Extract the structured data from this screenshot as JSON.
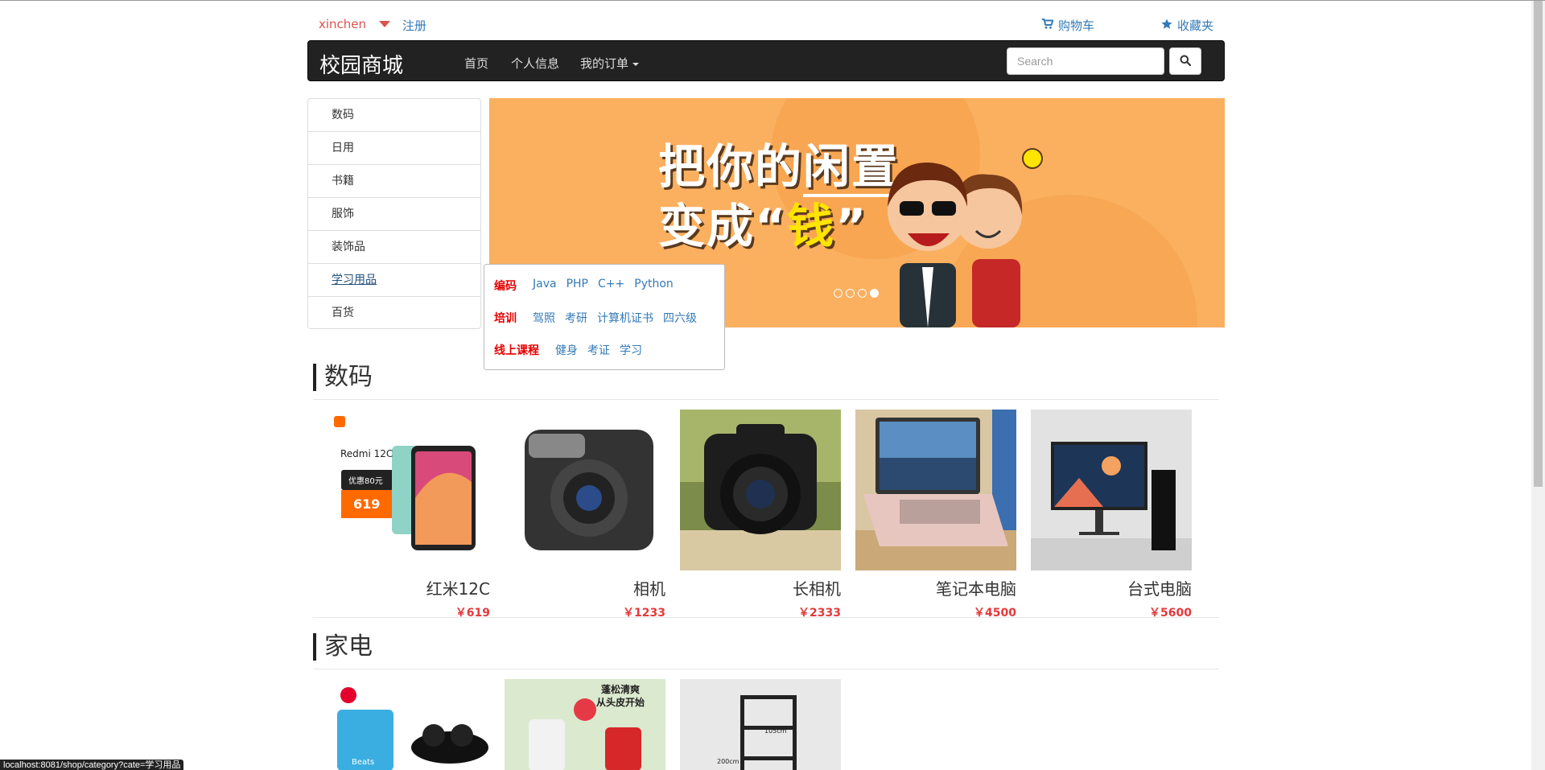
{
  "topbar": {
    "username": "xinchen",
    "register": "注册",
    "cart": "购物车",
    "favorites": "收藏夹"
  },
  "navbar": {
    "brand": "校园商城",
    "items": [
      "首页",
      "个人信息",
      "我的订单"
    ],
    "search_placeholder": "Search"
  },
  "categories": [
    "数码",
    "日用",
    "书籍",
    "服饰",
    "装饰品",
    "学习用品",
    "百货"
  ],
  "banner": {
    "line1_a": "把你的",
    "line1_b": "闲置",
    "line2_a": "变成“",
    "line2_b": "钱",
    "line2_c": "”",
    "dots_active": 4,
    "dots_total": 4
  },
  "popup": {
    "rows": [
      {
        "head": "编码",
        "links": [
          "Java",
          "PHP",
          "C++",
          "Python"
        ]
      },
      {
        "head": "培训",
        "links": [
          "驾照",
          "考研",
          "计算机证书",
          "四六级"
        ]
      },
      {
        "head": "线上课程",
        "links": [
          "健身",
          "考证",
          "学习"
        ]
      }
    ]
  },
  "sections": [
    {
      "title": "数码",
      "products": [
        {
          "name": "红米12C",
          "price": "￥619",
          "img_text": [
            "Redmi 12C",
            "优惠80元",
            "619"
          ]
        },
        {
          "name": "相机",
          "price": "￥1233"
        },
        {
          "name": "长相机",
          "price": "￥2333"
        },
        {
          "name": "笔记本电脑",
          "price": "￥4500"
        },
        {
          "name": "台式电脑",
          "price": "￥5600"
        }
      ]
    },
    {
      "title": "家电",
      "products": [
        {
          "name": "",
          "price": "",
          "img_text": [
            "Beats"
          ]
        },
        {
          "name": "",
          "price": "",
          "img_text": [
            "蓬松清爽",
            "从头皮开始"
          ]
        },
        {
          "name": "",
          "price": "",
          "img_text": [
            "105cm",
            "200cm"
          ]
        }
      ]
    }
  ],
  "status_url": "localhost:8081/shop/category?cate=学习用品",
  "colors": {
    "accent": "#337ab7",
    "price": "#e4393c",
    "navbar": "#222222",
    "banner": "#fbb060",
    "popup_head": "#e40000"
  }
}
